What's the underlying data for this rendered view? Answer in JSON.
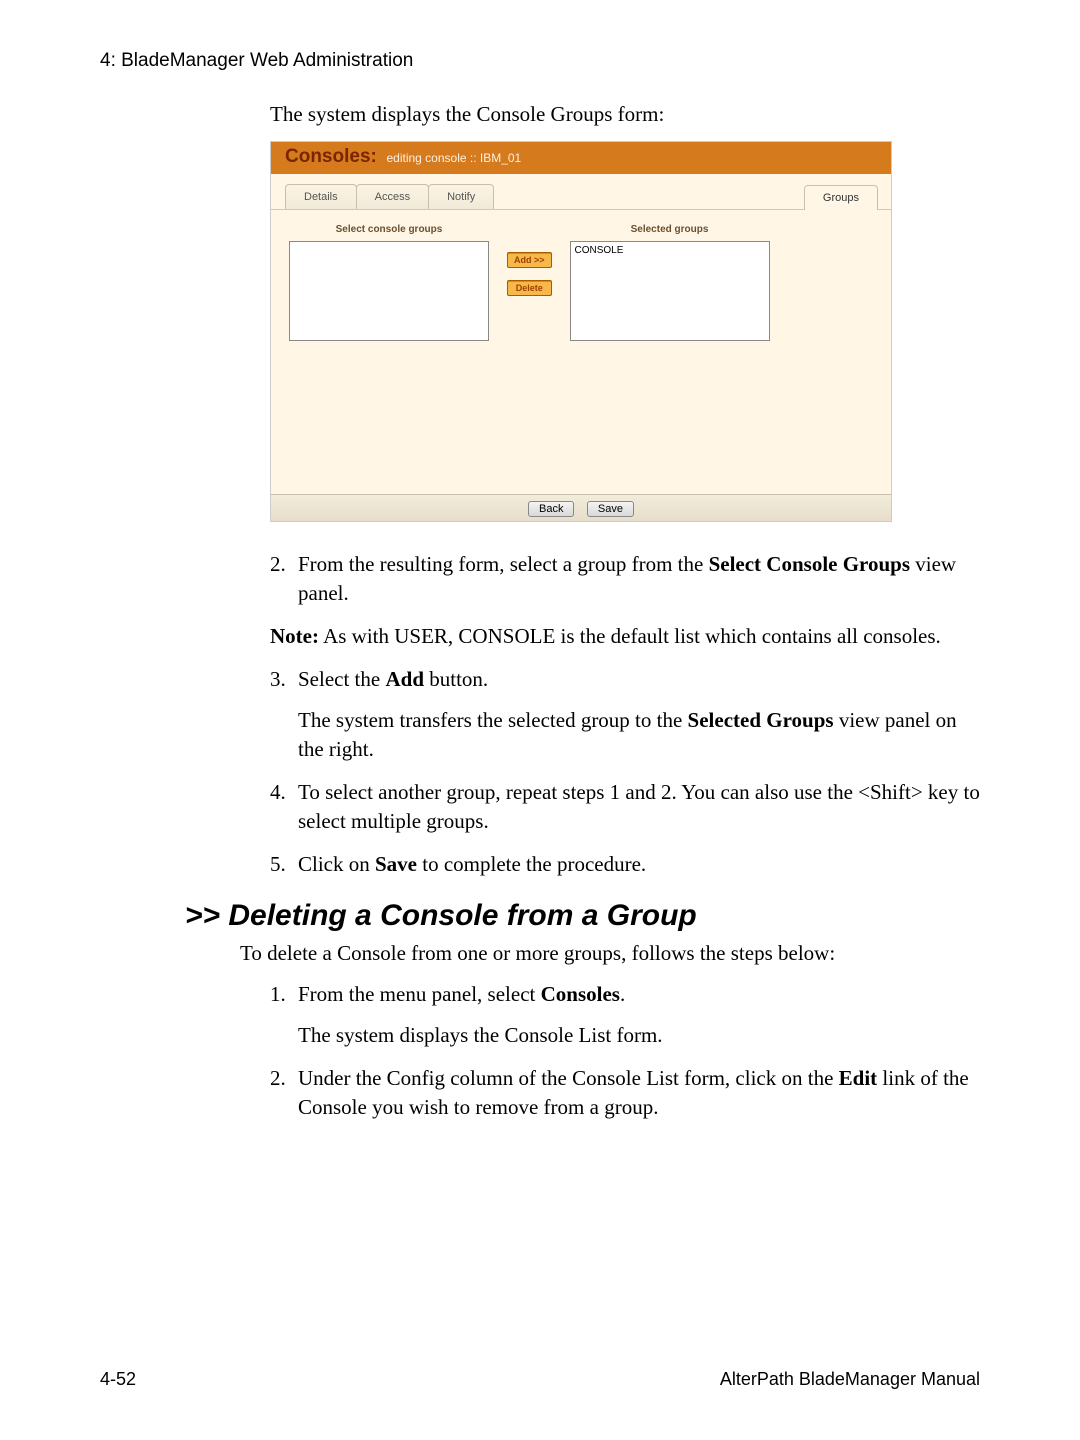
{
  "header": {
    "chapter_title": "4: BladeManager Web Administration"
  },
  "intro": "The system displays the Console Groups form:",
  "panel": {
    "title_big": "Consoles:",
    "title_crumbs": "editing console  ::  IBM_01",
    "tabs": [
      "Details",
      "Access",
      "Notify",
      "Groups"
    ],
    "active_tab_index": 3,
    "left_label": "Select console groups",
    "right_label": "Selected groups",
    "right_items": [
      "CONSOLE"
    ],
    "add_btn": "Add >>",
    "delete_btn": "Delete",
    "back_btn": "Back",
    "save_btn": "Save"
  },
  "stepsA": {
    "s2_num": "2.",
    "s2_a": "From the resulting form, select a group from the ",
    "s2_b": "Select Console Groups",
    "s2_c": " view panel.",
    "note_label": "Note:",
    "note_text": " As with USER, CONSOLE is the default list which contains all consoles.",
    "s3_num": "3.",
    "s3_a": "Select the ",
    "s3_b": "Add",
    "s3_c": " button.",
    "s3_follow_a": "The system transfers the selected group to the ",
    "s3_follow_b": "Selected Groups",
    "s3_follow_c": " view panel on the right.",
    "s4_num": "4.",
    "s4": "To select another group, repeat steps 1 and 2. You can also use the <Shift> key to select multiple groups.",
    "s5_num": "5.",
    "s5_a": "Click on ",
    "s5_b": "Save",
    "s5_c": " to complete the procedure."
  },
  "section2": {
    "heading": ">> Deleting a Console from a Group",
    "intro": "To delete a Console from one or more groups, follows the steps below:",
    "s1_num": "1.",
    "s1_a": "From the menu panel, select ",
    "s1_b": "Consoles",
    "s1_c": ".",
    "s1_follow": "The system displays the Console List form.",
    "s2_num": "2.",
    "s2_a": "Under the Config column of the Console List form, click on the ",
    "s2_b": "Edit",
    "s2_c": " link of the Console you wish to remove from a group."
  },
  "footer": {
    "left": "4-52",
    "right": "AlterPath BladeManager Manual"
  }
}
